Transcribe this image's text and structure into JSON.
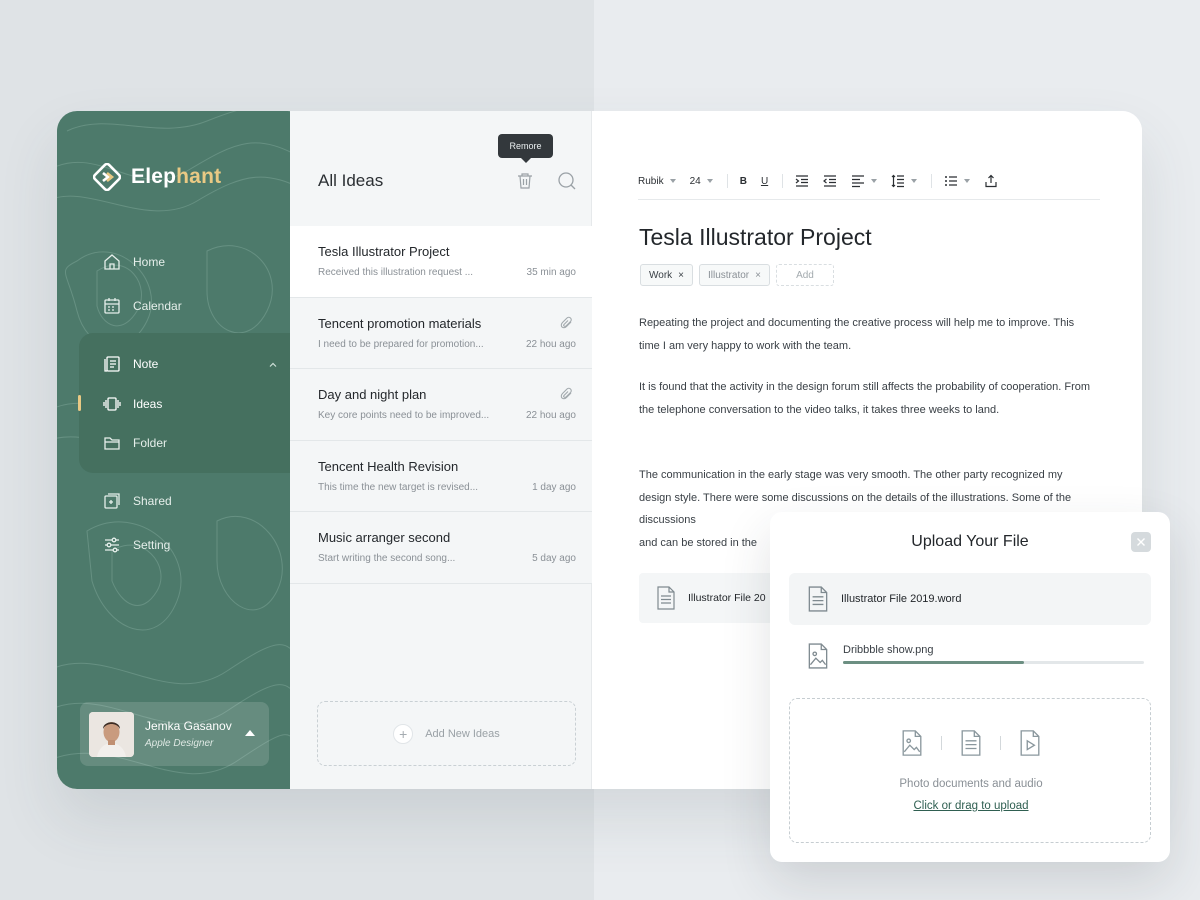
{
  "colors": {
    "brand": "#4d7a6b",
    "accent": "#e9c984",
    "progress": "#6c8f82"
  },
  "logo": {
    "part1": "Elep",
    "part2": "hant"
  },
  "nav": {
    "home": "Home",
    "calendar": "Calendar",
    "note": "Note",
    "ideas": "Ideas",
    "folder": "Folder",
    "shared": "Shared",
    "setting": "Setting"
  },
  "user": {
    "name": "Jemka Gasanov",
    "role": "Apple Designer"
  },
  "list": {
    "title": "All Ideas",
    "tooltip": "Remore",
    "add_label": "Add New Ideas",
    "items": [
      {
        "title": "Tesla Illustrator Project",
        "snippet": "Received this illustration request ...",
        "time": "35 min ago",
        "attachment": false
      },
      {
        "title": "Tencent promotion materials",
        "snippet": "I need to be prepared for promotion...",
        "time": "22 hou ago",
        "attachment": true
      },
      {
        "title": "Day and night plan",
        "snippet": "Key core points need to be improved...",
        "time": "22 hou ago",
        "attachment": true
      },
      {
        "title": "Tencent Health Revision",
        "snippet": "This time the new target is revised...",
        "time": "1 day ago",
        "attachment": false
      },
      {
        "title": "Music arranger second",
        "snippet": "Start writing the second song...",
        "time": "5 day ago",
        "attachment": false
      }
    ]
  },
  "toolbar": {
    "font": "Rubik",
    "size": "24",
    "bold": "B",
    "underline": "U"
  },
  "doc": {
    "title": "Tesla Illustrator Project",
    "tags": [
      "Work",
      "Illustrator"
    ],
    "add_tag": "Add",
    "paragraphs": [
      "Repeating the project and documenting the creative process will help me to improve. This time I am very happy to work with the team.",
      "It is found that the activity in the design forum still affects the probability of cooperation. From the telephone conversation to the video talks, it takes three weeks to land.",
      "The communication in the early stage was very smooth. The other party recognized my design style. There were some discussions on the details of the illustrations. Some of the discussions",
      "and can be stored in the"
    ],
    "attachment": "Illustrator File 20"
  },
  "upload": {
    "title": "Upload Your File",
    "file1": "Illustrator File 2019.word",
    "file2": "Dribbble show.png",
    "progress": 0.6,
    "drop_text": "Photo documents and audio",
    "drop_link": "Click or drag to upload"
  }
}
